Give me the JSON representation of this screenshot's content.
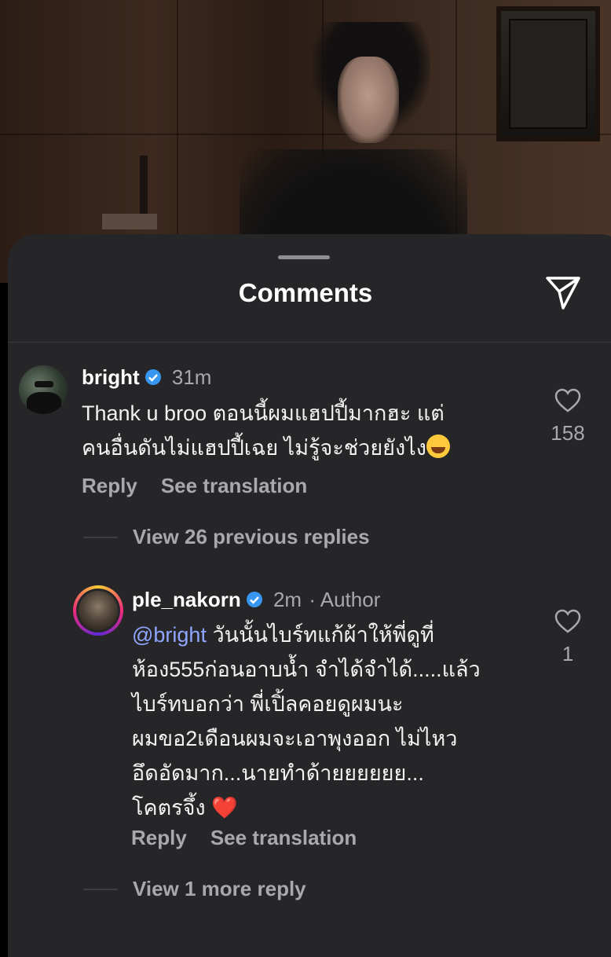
{
  "sheet": {
    "title": "Comments"
  },
  "comments": [
    {
      "username": "bright",
      "time": "31m",
      "text_line1": "Thank u broo ตอนนี้ผมแฮปปี้มากฮะ แต่",
      "text_line2": "คนอื่นดันไม่แฮปปี้เฉย ไม่รู้จะช่วยยังไง",
      "emoji": "laughing-tears",
      "likes": "158",
      "reply_label": "Reply",
      "translate_label": "See translation",
      "view_replies": "View 26 previous replies"
    },
    {
      "username": "ple_nakorn",
      "time": "2m",
      "author_badge": "· Author",
      "mention": "@bright",
      "text_line1": " วันนั้นไบร์ทแก้ผ้าให้พี่ดูที่",
      "text_line2": "ห้อง555ก่อนอาบน้ำ จำได้จำได้.....แล้ว",
      "text_line3": "ไบร์ทบอกว่า พี่เปิ้ลคอยดูผมนะ",
      "text_line4": "ผมขอ2เดือนผมจะเอาพุงออก ไม่ไหว",
      "text_line5": "อึดอัดมาก...นายทำด้ายยยยยย...",
      "text_line6": "โคตรจึ้ง",
      "emoji_heart": "❤️",
      "likes": "1",
      "reply_label": "Reply",
      "translate_label": "See translation",
      "view_replies": "View 1 more reply"
    }
  ],
  "colors": {
    "sheet_bg": "#262629",
    "mention": "#8fa6ff",
    "verified": "#3797f0",
    "muted": "#a8a8ad"
  }
}
